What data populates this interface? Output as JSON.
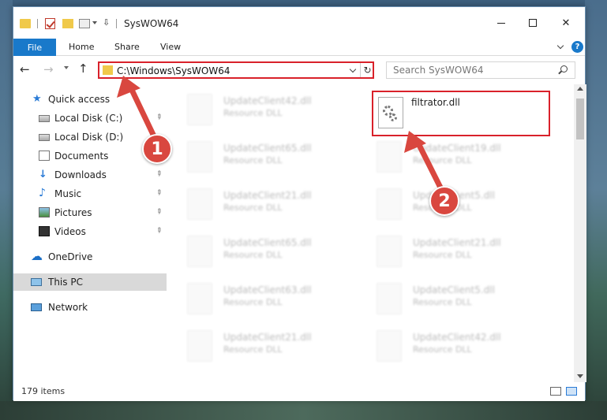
{
  "window": {
    "title": "SysWOW64",
    "controls": {
      "minimize": "",
      "maximize": "",
      "close": "✕"
    }
  },
  "ribbon": {
    "tabs": [
      "File",
      "Home",
      "Share",
      "View"
    ],
    "help": "?"
  },
  "address": {
    "path": "C:\\Windows\\SysWOW64",
    "refresh": "↻"
  },
  "search": {
    "placeholder": "Search SysWOW64"
  },
  "nav": {
    "back": "←",
    "forward": "→",
    "up": "↑"
  },
  "sidebar": {
    "items": [
      {
        "label": "Quick access",
        "icon": "star-icon"
      },
      {
        "label": "Local Disk (C:)",
        "icon": "disk-icon",
        "pinned": true
      },
      {
        "label": "Local Disk (D:)",
        "icon": "disk-icon"
      },
      {
        "label": "Documents",
        "icon": "documents-icon"
      },
      {
        "label": "Downloads",
        "icon": "downloads-icon",
        "pinned": true
      },
      {
        "label": "Music",
        "icon": "music-icon",
        "pinned": true
      },
      {
        "label": "Pictures",
        "icon": "pictures-icon",
        "pinned": true
      },
      {
        "label": "Videos",
        "icon": "videos-icon",
        "pinned": true
      },
      {
        "label": "OneDrive",
        "icon": "onedrive-icon"
      },
      {
        "label": "This PC",
        "icon": "this-pc-icon",
        "selected": true
      },
      {
        "label": "Network",
        "icon": "network-icon"
      }
    ],
    "pin_glyph": "📌"
  },
  "files": {
    "left_column": [
      {
        "name": "UpdateClient42.dll",
        "type": "Resource DLL"
      },
      {
        "name": "UpdateClient65.dll",
        "type": "Resource DLL"
      },
      {
        "name": "UpdateClient21.dll",
        "type": "Resource DLL"
      },
      {
        "name": "UpdateClient65.dll",
        "type": "Resource DLL"
      },
      {
        "name": "UpdateClient63.dll",
        "type": "Resource DLL"
      },
      {
        "name": "UpdateClient21.dll",
        "type": "Resource DLL"
      }
    ],
    "right_column": [
      {
        "name": "filtrator.dll",
        "type": "",
        "highlighted": true
      },
      {
        "name": "UpdateClient19.dll",
        "type": "Resource DLL"
      },
      {
        "name": "UpdateClient5.dll",
        "type": "Resource DLL"
      },
      {
        "name": "UpdateClient21.dll",
        "type": "Resource DLL"
      },
      {
        "name": "UpdateClient5.dll",
        "type": "Resource DLL"
      },
      {
        "name": "UpdateClient42.dll",
        "type": "Resource DLL"
      }
    ]
  },
  "status": {
    "count": "179 items"
  },
  "annotations": [
    {
      "number": "1"
    },
    {
      "number": "2"
    }
  ],
  "colors": {
    "accent": "#1979ca",
    "highlight": "#d9212a",
    "callout": "#d9473f"
  }
}
